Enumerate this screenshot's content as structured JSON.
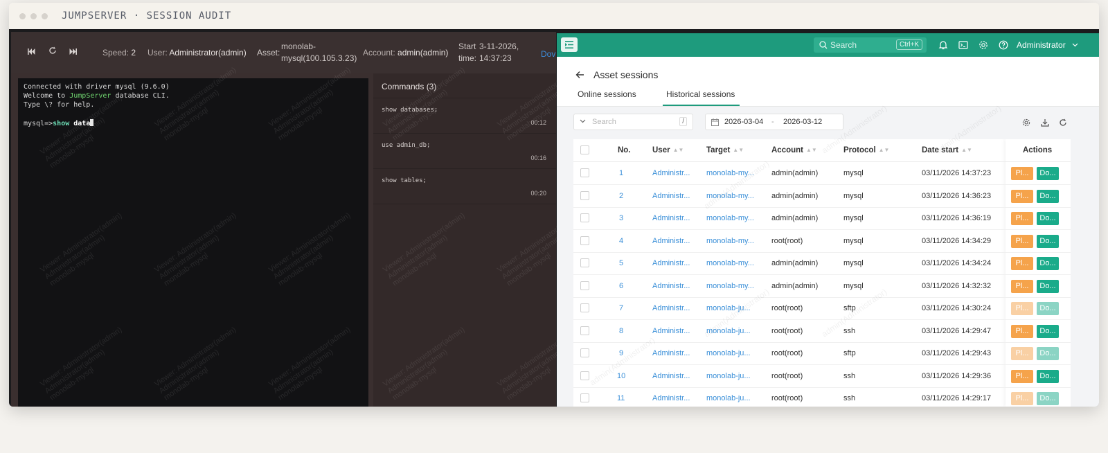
{
  "window": {
    "title": "JUMPSERVER · SESSION AUDIT"
  },
  "replay": {
    "controls": {
      "prev_icon": "skip-back-icon",
      "replay_icon": "refresh-icon",
      "next_icon": "skip-forward-icon"
    },
    "speed_label": "Speed:",
    "speed_value": "2",
    "user_label": "User:",
    "user_value": "Administrator(admin)",
    "asset_label": "Asset:",
    "asset_value_line1": "monolab-",
    "asset_value_line2": "mysql(100.105.3.23)",
    "account_label": "Account:",
    "account_value": "admin(admin)",
    "start_label_line1": "Start",
    "start_label_line2": "time:",
    "start_value_line1": "3-11-2026,",
    "start_value_line2": "14:37:23",
    "download_partial": "Dov",
    "watermark": {
      "line1": "Viewer: Administrator(admin)",
      "line2": "Administrator(admin)",
      "line3": "monolab-mysql"
    },
    "terminal": {
      "line1": "Connected with driver mysql (9.6.0)",
      "line2_pre": "Welcome to ",
      "line2_hl": "JumpServer",
      "line2_post": " database CLI.",
      "line3": "Type \\? for help.",
      "prompt": "mysql=>",
      "cmd": "show",
      "arg": " data"
    },
    "commands": {
      "header": "Commands (3)",
      "items": [
        {
          "text": "show databases;",
          "time": "00:12"
        },
        {
          "text": "use admin_db;",
          "time": "00:16"
        },
        {
          "text": "show tables;",
          "time": "00:20"
        }
      ]
    }
  },
  "app": {
    "header": {
      "search_placeholder": "Search",
      "search_shortcut": "Ctrl+K",
      "user": "Administrator",
      "icons": [
        "bell-icon",
        "terminal-icon",
        "settings-icon",
        "help-icon"
      ]
    },
    "page_title": "Asset sessions",
    "tabs": [
      {
        "label": "Online sessions"
      },
      {
        "label": "Historical sessions"
      }
    ],
    "filters": {
      "search_placeholder": "Search",
      "slash": "/",
      "date_from": "2026-03-04",
      "date_sep": "-",
      "date_to": "2026-03-12"
    },
    "watermark": "admin(Administrator)",
    "table": {
      "columns": [
        "No.",
        "User",
        "Target",
        "Account",
        "Protocol",
        "Date start",
        "Actions"
      ],
      "rows": [
        {
          "no": "1",
          "user": "Administr...",
          "target": "monolab-my...",
          "account": "admin(admin)",
          "protocol": "mysql",
          "date": "03/11/2026 14:37:23",
          "play": "Pl...",
          "dl": "Do...",
          "faded": false
        },
        {
          "no": "2",
          "user": "Administr...",
          "target": "monolab-my...",
          "account": "admin(admin)",
          "protocol": "mysql",
          "date": "03/11/2026 14:36:23",
          "play": "Pl...",
          "dl": "Do...",
          "faded": false
        },
        {
          "no": "3",
          "user": "Administr...",
          "target": "monolab-my...",
          "account": "admin(admin)",
          "protocol": "mysql",
          "date": "03/11/2026 14:36:19",
          "play": "Pl...",
          "dl": "Do...",
          "faded": false
        },
        {
          "no": "4",
          "user": "Administr...",
          "target": "monolab-my...",
          "account": "root(root)",
          "protocol": "mysql",
          "date": "03/11/2026 14:34:29",
          "play": "Pl...",
          "dl": "Do...",
          "faded": false
        },
        {
          "no": "5",
          "user": "Administr...",
          "target": "monolab-my...",
          "account": "admin(admin)",
          "protocol": "mysql",
          "date": "03/11/2026 14:34:24",
          "play": "Pl...",
          "dl": "Do...",
          "faded": false
        },
        {
          "no": "6",
          "user": "Administr...",
          "target": "monolab-my...",
          "account": "admin(admin)",
          "protocol": "mysql",
          "date": "03/11/2026 14:32:32",
          "play": "Pl...",
          "dl": "Do...",
          "faded": false
        },
        {
          "no": "7",
          "user": "Administr...",
          "target": "monolab-ju...",
          "account": "root(root)",
          "protocol": "sftp",
          "date": "03/11/2026 14:30:24",
          "play": "Pl...",
          "dl": "Do...",
          "faded": true
        },
        {
          "no": "8",
          "user": "Administr...",
          "target": "monolab-ju...",
          "account": "root(root)",
          "protocol": "ssh",
          "date": "03/11/2026 14:29:47",
          "play": "Pl...",
          "dl": "Do...",
          "faded": false
        },
        {
          "no": "9",
          "user": "Administr...",
          "target": "monolab-ju...",
          "account": "root(root)",
          "protocol": "sftp",
          "date": "03/11/2026 14:29:43",
          "play": "Pl...",
          "dl": "Do...",
          "faded": true
        },
        {
          "no": "10",
          "user": "Administr...",
          "target": "monolab-ju...",
          "account": "root(root)",
          "protocol": "ssh",
          "date": "03/11/2026 14:29:36",
          "play": "Pl...",
          "dl": "Do...",
          "faded": false
        },
        {
          "no": "11",
          "user": "Administr...",
          "target": "monolab-ju...",
          "account": "root(root)",
          "protocol": "ssh",
          "date": "03/11/2026 14:29:17",
          "play": "Pl...",
          "dl": "Do...",
          "faded": true
        }
      ]
    }
  },
  "colors": {
    "brand": "#1e9b7d",
    "play": "#f5a34b",
    "download": "#1aab8a",
    "link": "#3a8fd8"
  }
}
